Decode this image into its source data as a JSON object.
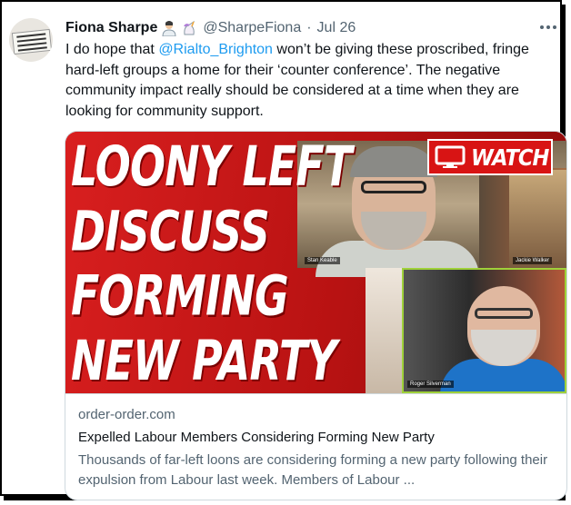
{
  "tweet": {
    "name": "Fiona Sharpe",
    "emojis": [
      "person-in-lab-coat-emoji",
      "unicorn-emoji"
    ],
    "handle": "@SharpeFiona",
    "separator": "·",
    "date": "Jul 26",
    "text_before": "I do hope that ",
    "mention": "@Rialto_Brighton",
    "text_after": " won’t be giving these proscribed, fringe hard-left groups a home for their ‘counter conference’.  The negative community impact really should be considered at a time when they are looking for community support."
  },
  "media": {
    "headline_lines": [
      "LOONY LEFT",
      "DISCUSS",
      "FORMING",
      "NEW PARTY"
    ],
    "watch_label": "WATCH",
    "participant_labels": [
      "Stan Keable",
      "Jackie Walker",
      "Roger Silverman"
    ]
  },
  "card": {
    "domain": "order-order.com",
    "title": "Expelled Labour Members Considering Forming New Party",
    "description": "Thousands of far-left loons are considering forming a new party following their expulsion from Labour last week. Members of Labour ..."
  },
  "colors": {
    "link": "#1d9bf0",
    "text": "#0f1419",
    "secondary": "#536471",
    "thumbnail_red": "#c91818"
  }
}
